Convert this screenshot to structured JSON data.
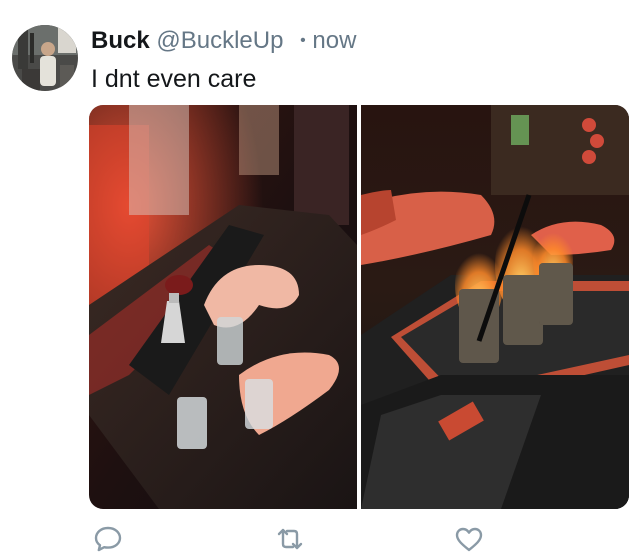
{
  "tweet": {
    "author_name": "Buck",
    "author_handle": "@BuckleUp",
    "separator": "•",
    "timestamp": "now",
    "text": "I dnt even care"
  },
  "media": [
    {
      "name": "left-photo",
      "description_icon": "shots-on-bar-photo"
    },
    {
      "name": "right-photo",
      "description_icon": "flaming-shots-photo"
    }
  ],
  "actions": [
    {
      "name": "reply",
      "icon": "speech-bubble-icon"
    },
    {
      "name": "retweet",
      "icon": "retweet-arrows-icon"
    },
    {
      "name": "like",
      "icon": "heart-icon"
    }
  ],
  "colors": {
    "text": "#14171a",
    "secondary": "#657786",
    "icon": "#8a9aa6"
  }
}
